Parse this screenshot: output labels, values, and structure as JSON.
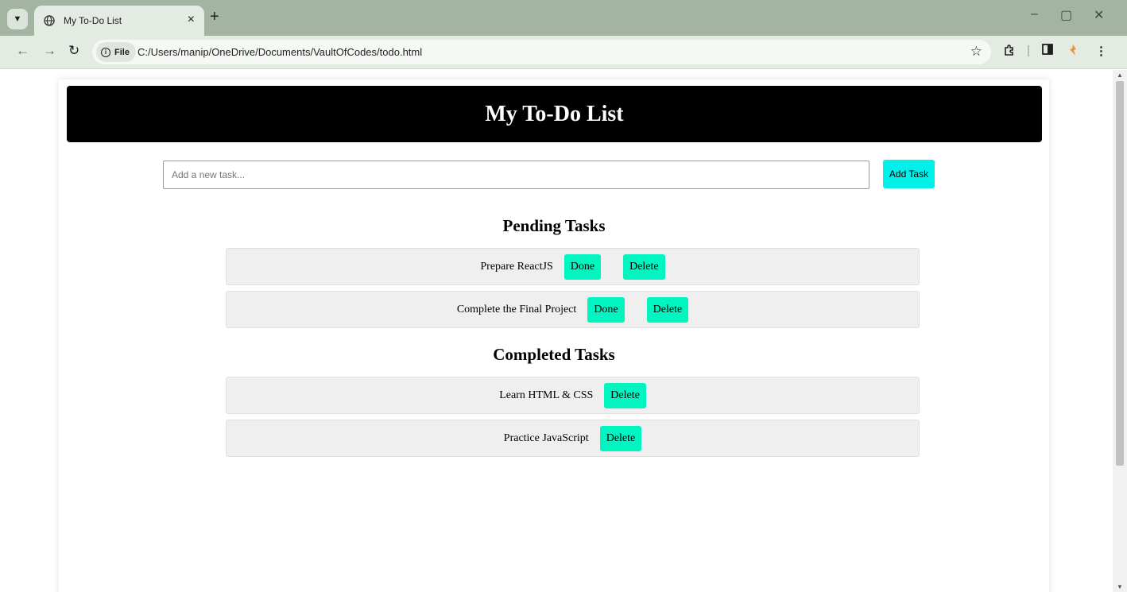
{
  "browser": {
    "tab_title": "My To-Do List",
    "new_tab": "+",
    "close_tab": "×",
    "security_chip": "File",
    "url": "C:/Users/manip/OneDrive/Documents/VaultOfCodes/todo.html"
  },
  "page": {
    "title": "My To-Do List",
    "input_placeholder": "Add a new task...",
    "add_button": "Add Task",
    "pending_title": "Pending Tasks",
    "completed_title": "Completed Tasks",
    "done_label": "Done",
    "delete_label": "Delete",
    "pending_tasks": [
      "Prepare ReactJS",
      "Complete the Final Project"
    ],
    "completed_tasks": [
      "Learn HTML & CSS",
      "Practice JavaScript"
    ]
  },
  "colors": {
    "header_bg": "#000000",
    "add_button_bg": "#00f0ea",
    "task_button_bg": "#00f5c0",
    "task_row_bg": "#efefef"
  }
}
